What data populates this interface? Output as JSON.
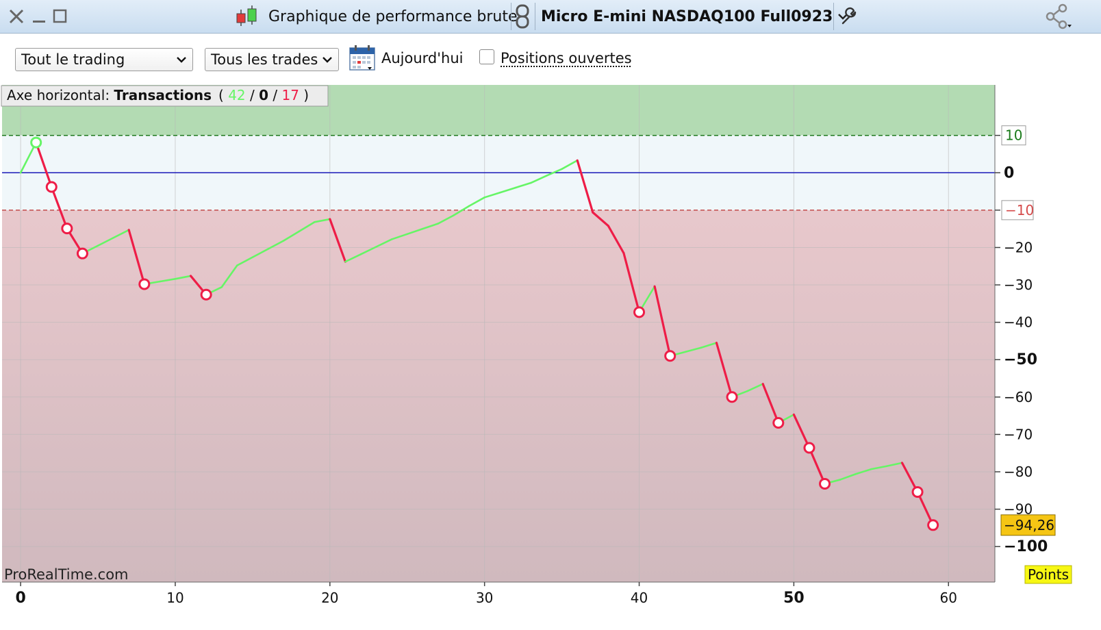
{
  "titlebar": {
    "title": "Graphique de performance brute",
    "instrument": "Micro E-mini NASDAQ100 Full0923"
  },
  "toolbar": {
    "period_select": "Tout le trading",
    "trades_select": "Tous les trades",
    "today_label": "Aujourd'hui",
    "open_positions_label": "Positions ouvertes"
  },
  "legend": {
    "prefix": "Axe horizontal: ",
    "name": "Transactions",
    "open_paren": "( ",
    "wins": "42",
    "sep1": " / ",
    "neutral": "0",
    "sep2": " / ",
    "losses": "17",
    "close_paren": " )"
  },
  "watermark": "ProRealTime.com",
  "unit_badge": "Points",
  "colors": {
    "win": "#66f566",
    "loss": "#ee1d47",
    "zero_line": "#1a1ab8",
    "upper_zone": "#b3dbb3",
    "neutral_zone": "#f0f7fa",
    "value_badge": "#f5c514",
    "unit_badge": "#f7f714"
  },
  "chart_data": {
    "type": "line",
    "xlabel": "Transactions",
    "ylabel": "Points",
    "xlim": [
      -1.2,
      63
    ],
    "ylim": [
      -109.5,
      23.5
    ],
    "x_ticks": [
      {
        "value": 0,
        "label": "0",
        "bold": true
      },
      {
        "value": 10,
        "label": "10",
        "bold": false
      },
      {
        "value": 20,
        "label": "20",
        "bold": false
      },
      {
        "value": 30,
        "label": "30",
        "bold": false
      },
      {
        "value": 40,
        "label": "40",
        "bold": false
      },
      {
        "value": 50,
        "label": "50",
        "bold": true
      },
      {
        "value": 60,
        "label": "60",
        "bold": false
      }
    ],
    "y_ticks": [
      {
        "value": 0,
        "label": "0",
        "bold": true
      },
      {
        "value": -20,
        "label": "−20",
        "bold": false
      },
      {
        "value": -30,
        "label": "−30",
        "bold": false
      },
      {
        "value": -40,
        "label": "−40",
        "bold": false
      },
      {
        "value": -50,
        "label": "−50",
        "bold": true
      },
      {
        "value": -60,
        "label": "−60",
        "bold": false
      },
      {
        "value": -70,
        "label": "−70",
        "bold": false
      },
      {
        "value": -80,
        "label": "−80",
        "bold": false
      },
      {
        "value": -90,
        "label": "−90",
        "bold": false
      },
      {
        "value": -100,
        "label": "−100",
        "bold": true
      }
    ],
    "thresholds": {
      "upper": 10,
      "upper_label": "10",
      "lower": -10,
      "lower_label": "−10"
    },
    "last_value": -94.26,
    "last_value_label": "−94,26",
    "x": [
      0,
      1,
      2,
      3,
      4,
      5,
      6,
      7,
      8,
      9,
      10,
      11,
      12,
      13,
      14,
      15,
      16,
      17,
      18,
      19,
      20,
      21,
      22,
      23,
      24,
      25,
      26,
      27,
      28,
      29,
      30,
      31,
      32,
      33,
      34,
      35,
      36,
      37,
      38,
      39,
      40,
      41,
      42,
      43,
      44,
      45,
      46,
      47,
      48,
      49,
      50,
      51,
      52,
      53,
      54,
      55,
      56,
      57,
      58,
      59
    ],
    "y": [
      0,
      8.1,
      -3.8,
      -14.9,
      -21.6,
      -19.5,
      -17.4,
      -15.3,
      -29.8,
      -29.1,
      -28.4,
      -27.6,
      -32.6,
      -30.6,
      -24.8,
      -22.6,
      -20.4,
      -18.2,
      -15.7,
      -13.2,
      -12.4,
      -23.8,
      -21.8,
      -19.8,
      -17.8,
      -16.4,
      -15,
      -13.6,
      -11.4,
      -8.9,
      -6.6,
      -5.3,
      -4,
      -2.7,
      -0.8,
      1,
      3.3,
      -10.6,
      -14.2,
      -21.5,
      -37.3,
      -30.4,
      -49,
      -47.9,
      -46.8,
      -45.5,
      -60,
      -58.4,
      -56.5,
      -66.9,
      -64.7,
      -73.6,
      -83.2,
      -82.1,
      -80.6,
      -79.3,
      -78.5,
      -77.6,
      -85.4,
      -94.26
    ],
    "markers": [
      {
        "x": 1,
        "y": 8.1,
        "kind": "win"
      },
      {
        "x": 2,
        "y": -3.8,
        "kind": "loss"
      },
      {
        "x": 3,
        "y": -14.9,
        "kind": "loss"
      },
      {
        "x": 4,
        "y": -21.6,
        "kind": "loss"
      },
      {
        "x": 8,
        "y": -29.8,
        "kind": "loss"
      },
      {
        "x": 12,
        "y": -32.6,
        "kind": "loss"
      },
      {
        "x": 40,
        "y": -37.3,
        "kind": "loss"
      },
      {
        "x": 42,
        "y": -49,
        "kind": "loss"
      },
      {
        "x": 46,
        "y": -60,
        "kind": "loss"
      },
      {
        "x": 49,
        "y": -66.9,
        "kind": "loss"
      },
      {
        "x": 51,
        "y": -73.6,
        "kind": "loss"
      },
      {
        "x": 52,
        "y": -83.2,
        "kind": "loss"
      },
      {
        "x": 58,
        "y": -85.4,
        "kind": "loss"
      },
      {
        "x": 59,
        "y": -94.26,
        "kind": "loss"
      }
    ]
  }
}
